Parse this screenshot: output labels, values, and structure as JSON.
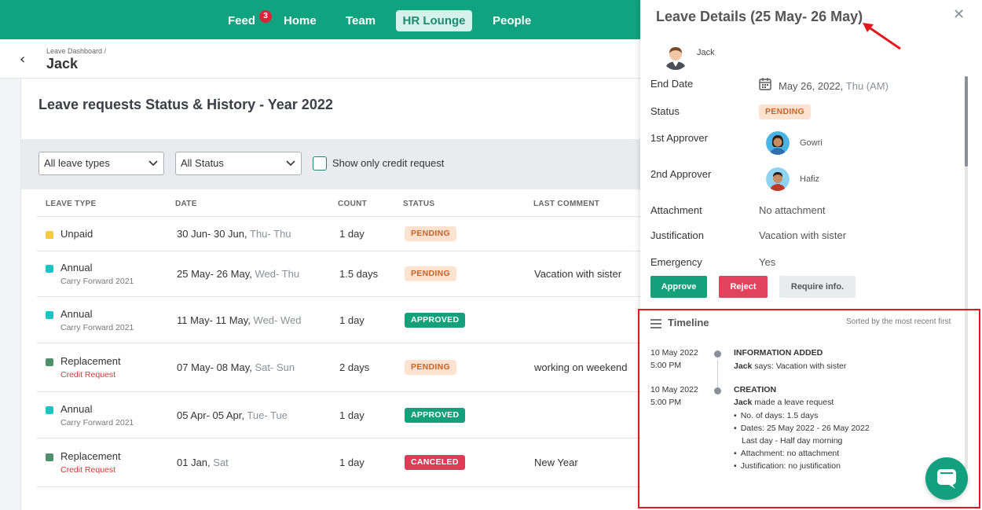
{
  "topnav": {
    "feed": "Feed",
    "feed_badge": "3",
    "home": "Home",
    "team": "Team",
    "hr_lounge": "HR Lounge",
    "people": "People"
  },
  "header": {
    "breadcrumb": "Leave Dashboard /",
    "title": "Jack"
  },
  "main": {
    "title": "Leave requests Status & History - Year 2022",
    "filters": {
      "leave_type": "All leave types",
      "status": "All Status",
      "credit_only_label": "Show only credit request"
    },
    "columns": [
      "LEAVE TYPE",
      "DATE",
      "COUNT",
      "STATUS",
      "LAST COMMENT"
    ],
    "rows": [
      {
        "type": "Unpaid",
        "sub": "",
        "dot_color": "#f7c93e",
        "date": "30 Jun- 30 Jun,",
        "days": "Thu- Thu",
        "count": "1 day",
        "status": "PENDING",
        "comment": ""
      },
      {
        "type": "Annual",
        "sub": "Carry Forward 2021",
        "dot_color": "#19c4c2",
        "date": "25 May- 26 May,",
        "days": "Wed- Thu",
        "count": "1.5 days",
        "status": "PENDING",
        "comment": "Vacation with sister"
      },
      {
        "type": "Annual",
        "sub": "Carry Forward 2021",
        "dot_color": "#19c4c2",
        "date": "11 May- 11 May,",
        "days": "Wed- Wed",
        "count": "1 day",
        "status": "APPROVED",
        "comment": ""
      },
      {
        "type": "Replacement",
        "sub": "Credit Request",
        "dot_color": "#4f8f6b",
        "date": "07 May- 08 May,",
        "days": "Sat- Sun",
        "count": "2 days",
        "status": "PENDING",
        "comment": "working on weekend"
      },
      {
        "type": "Annual",
        "sub": "Carry Forward 2021",
        "dot_color": "#19c4c2",
        "date": "05 Apr- 05 Apr,",
        "days": "Tue- Tue",
        "count": "1 day",
        "status": "APPROVED",
        "comment": ""
      },
      {
        "type": "Replacement",
        "sub": "Credit Request",
        "dot_color": "#4f8f6b",
        "date": "01 Jan,",
        "days": "Sat",
        "count": "1 day",
        "status": "CANCELED",
        "comment": "New Year"
      }
    ]
  },
  "panel": {
    "title": "Leave Details (25 May- 26 May)",
    "employee": "Jack",
    "end_date_label": "End Date",
    "end_date": "May 26, 2022,",
    "end_date_day": "Thu (AM)",
    "status_label": "Status",
    "status": "PENDING",
    "approver1_label": "1st Approver",
    "approver1": "Gowri",
    "approver2_label": "2nd Approver",
    "approver2": "Hafiz",
    "attachment_label": "Attachment",
    "attachment": "No attachment",
    "justification_label": "Justification",
    "justification": "Vacation with sister",
    "emergency_label": "Emergency",
    "emergency": "Yes",
    "approve": "Approve",
    "reject": "Reject",
    "require_info": "Require info.",
    "timeline": {
      "title": "Timeline",
      "sort_note": "Sorted by the most recent first",
      "events": [
        {
          "date": "10 May 2022",
          "time": "5:00 PM",
          "heading": "INFORMATION ADDED",
          "actor": "Jack",
          "text": "says: Vacation with sister"
        },
        {
          "date": "10 May 2022",
          "time": "5:00 PM",
          "heading": "CREATION",
          "actor": "Jack",
          "text": "made a leave request",
          "details": [
            "No. of days: 1.5 days",
            "Dates: 25 May 2022 - 26 May 2022",
            "Last day - Half day morning",
            "Attachment: no attachment",
            "Justification: no justification"
          ]
        }
      ]
    }
  }
}
